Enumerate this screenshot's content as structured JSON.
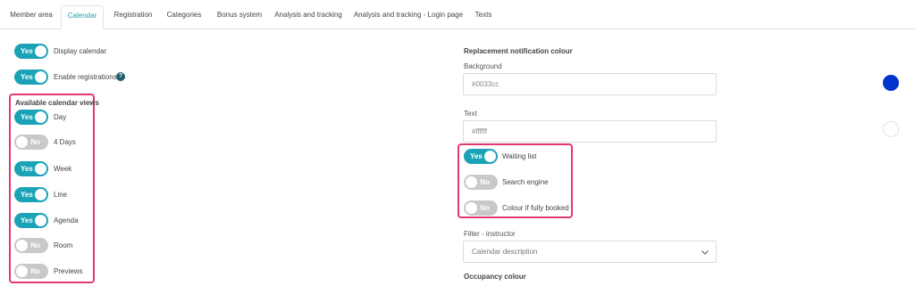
{
  "tabs": [
    {
      "label": "Member area",
      "active": false
    },
    {
      "label": "Calendar",
      "active": true
    },
    {
      "label": "Registration",
      "active": false
    },
    {
      "label": "Categories",
      "active": false
    },
    {
      "label": "Bonus system",
      "active": false
    },
    {
      "label": "Analysis and tracking",
      "active": false
    },
    {
      "label": "Analysis and tracking - Login page",
      "active": false
    },
    {
      "label": "Texts",
      "active": false
    }
  ],
  "toggle_text": {
    "on": "Yes",
    "off": "No"
  },
  "left": {
    "display_calendar": {
      "label": "Display calendar",
      "on": true
    },
    "enable_registrations": {
      "label": "Enable registrations",
      "on": true
    },
    "help_glyph": "?",
    "views_heading": "Available calendar views",
    "views": [
      {
        "label": "Day",
        "on": true
      },
      {
        "label": "4 Days",
        "on": false
      },
      {
        "label": "Week",
        "on": true
      },
      {
        "label": "Line",
        "on": true
      },
      {
        "label": "Agenda",
        "on": true
      },
      {
        "label": "Room",
        "on": false
      },
      {
        "label": "Previews",
        "on": false
      }
    ]
  },
  "right": {
    "notification_heading": "Replacement notification colour",
    "background_label": "Background",
    "background_value": "#0033cc",
    "text_label": "Text",
    "text_value": "#ffffff",
    "options": [
      {
        "label": "Waiting list",
        "on": true
      },
      {
        "label": "Search engine",
        "on": false
      },
      {
        "label": "Colour if fully booked",
        "on": false
      }
    ],
    "filter_label": "Filter - instructor",
    "filter_value": "Calendar description",
    "occupancy_heading": "Occupancy colour"
  },
  "colors": {
    "accent": "#1aa3b7",
    "toggle_off": "#c9c9c9",
    "highlight": "#e5386f",
    "swatch_background": "#0033cc",
    "swatch_text": "#ffffff"
  },
  "icons": {
    "dropdown": "chevron-down-icon",
    "help": "help-icon"
  }
}
